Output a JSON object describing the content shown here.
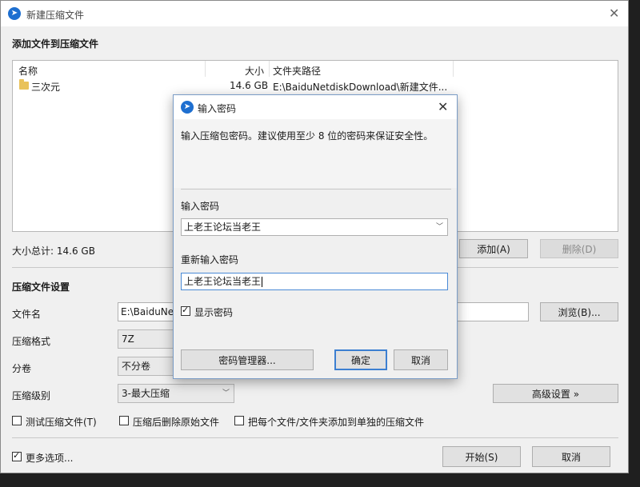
{
  "window": {
    "title": "新建压缩文件",
    "add_files_title": "添加文件到压缩文件",
    "columns": [
      "名称",
      "大小",
      "文件夹路径"
    ],
    "rows": [
      {
        "name": "三次元",
        "size": "14.6 GB",
        "path": "E:\\BaiduNetdiskDownload\\新建文件..."
      }
    ],
    "total_size": "大小总计: 14.6 GB",
    "add_button": "添加(A)",
    "delete_button": "删除(D)",
    "settings_title": "压缩文件设置",
    "filename_label": "文件名",
    "filename_value": "E:\\BaiduNet",
    "browse_button": "浏览(B)...",
    "format_label": "压缩格式",
    "format_value": "7Z",
    "split_label": "分卷",
    "split_value": "不分卷",
    "level_label": "压缩级别",
    "level_value": "3-最大压缩",
    "advanced_button": "高级设置 »",
    "test_archive": "测试压缩文件(T)",
    "delete_after": "压缩后删除原始文件",
    "each_separate": "把每个文件/文件夹添加到单独的压缩文件",
    "more_options": "更多选项...",
    "start_button": "开始(S)",
    "cancel_button": "取消"
  },
  "dialog": {
    "title": "输入密码",
    "info": "输入压缩包密码。建议使用至少 8 位的密码来保证安全性。",
    "password_label": "输入密码",
    "password_value": "上老王论坛当老王",
    "reenter_label": "重新输入密码",
    "reenter_value": "上老王论坛当老王",
    "show_password": "显示密码",
    "manager_button": "密码管理器...",
    "ok_button": "确定",
    "cancel_button": "取消"
  },
  "icons": {
    "app": "app-logo-icon",
    "folder": "folder-icon",
    "close": "close-icon"
  },
  "colors": {
    "accent": "#1e6fd0",
    "focus": "#4a8ad6",
    "folder": "#e9c25a"
  }
}
